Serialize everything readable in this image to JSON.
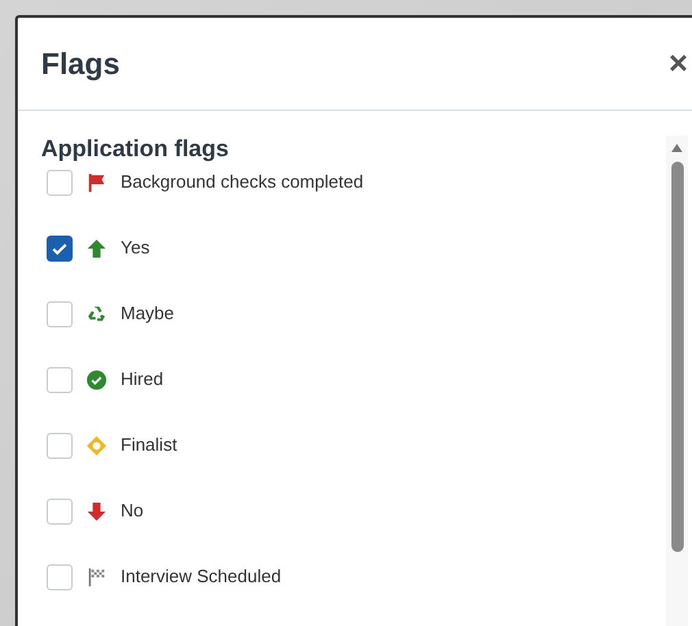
{
  "dialog": {
    "title": "Flags",
    "close": "×"
  },
  "section": {
    "heading": "Application flags",
    "flags": [
      {
        "kind": "flag",
        "label": "Background checks completed",
        "checked": false
      },
      {
        "kind": "up",
        "label": "Yes",
        "checked": true
      },
      {
        "kind": "recycle",
        "label": "Maybe",
        "checked": false
      },
      {
        "kind": "hired",
        "label": "Hired",
        "checked": false
      },
      {
        "kind": "finalist",
        "label": "Finalist",
        "checked": false
      },
      {
        "kind": "down",
        "label": "No",
        "checked": false
      },
      {
        "kind": "checkered",
        "label": "Interview Scheduled",
        "checked": false
      }
    ]
  }
}
